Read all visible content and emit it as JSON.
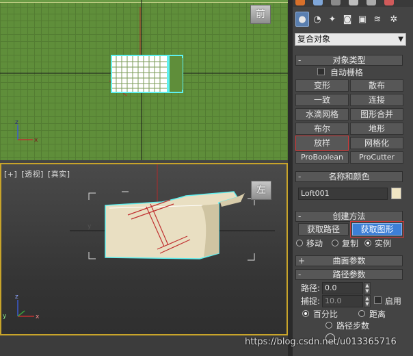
{
  "viewports": {
    "front": {
      "viewcube_label": "前"
    },
    "perspective": {
      "label_parts": [
        "[+]",
        "[透视]",
        "[真实]"
      ],
      "viewcube_label": "左"
    }
  },
  "command_panel": {
    "category_icons": [
      "geometry-icon",
      "shapes-icon",
      "lights-icon",
      "cameras-icon",
      "helpers-icon",
      "space-warps-icon",
      "systems-icon"
    ],
    "object_category": "复合对象",
    "object_type": {
      "title": "对象类型",
      "autogrid_label": "自动栅格",
      "autogrid_checked": false,
      "buttons": [
        "变形",
        "散布",
        "一致",
        "连接",
        "水滴网格",
        "图形合并",
        "布尔",
        "地形",
        "放样",
        "网格化",
        "ProBoolean",
        "ProCutter"
      ],
      "highlighted": "放样"
    },
    "name_color": {
      "title": "名称和颜色",
      "name_value": "Loft001",
      "color": "#f1e6c4"
    },
    "creation_method": {
      "title": "创建方法",
      "get_path_label": "获取路径",
      "get_shape_label": "获取图形",
      "move_label": "移动",
      "copy_label": "复制",
      "instance_label": "实例",
      "selected_mode": "实例"
    },
    "surface_params": {
      "title": "曲面参数"
    },
    "path_params": {
      "title": "路径参数",
      "path_label": "路径:",
      "path_value": "0.0",
      "snap_label": "捕捉:",
      "snap_value": "10.0",
      "enable_label": "启用",
      "percent_label": "百分比",
      "distance_label": "距离",
      "path_steps_label": "路径步数",
      "selected_mode": "百分比"
    }
  },
  "watermark": "https://blog.csdn.net/u013365716",
  "colors": {
    "viewport_front_bg": "#5f8e3a",
    "selection_cyan": "#5ef0f0",
    "active_blue": "#3d7fd6",
    "highlight_red": "#d23a3a",
    "active_border": "#c8a42a"
  }
}
